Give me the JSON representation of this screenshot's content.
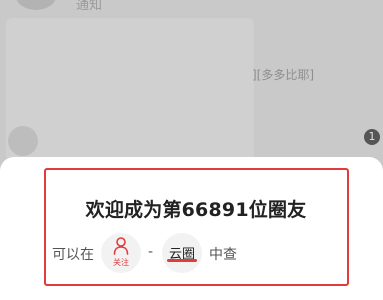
{
  "background": {
    "top_text": "通知",
    "mid_text": "][多多比耶]",
    "bottom_text": "",
    "badge": "1"
  },
  "popup": {
    "title": "欢迎成为第66891位圈友",
    "instruction_prefix": "可以在",
    "follow_label": "关注",
    "separator": "-",
    "yunquan_label": "云圈",
    "instruction_suffix": "中查"
  },
  "colors": {
    "accent_red": "#e23b3b",
    "overlay_gray": "#c9c9c9"
  },
  "icons": {
    "follow": "person-icon"
  }
}
